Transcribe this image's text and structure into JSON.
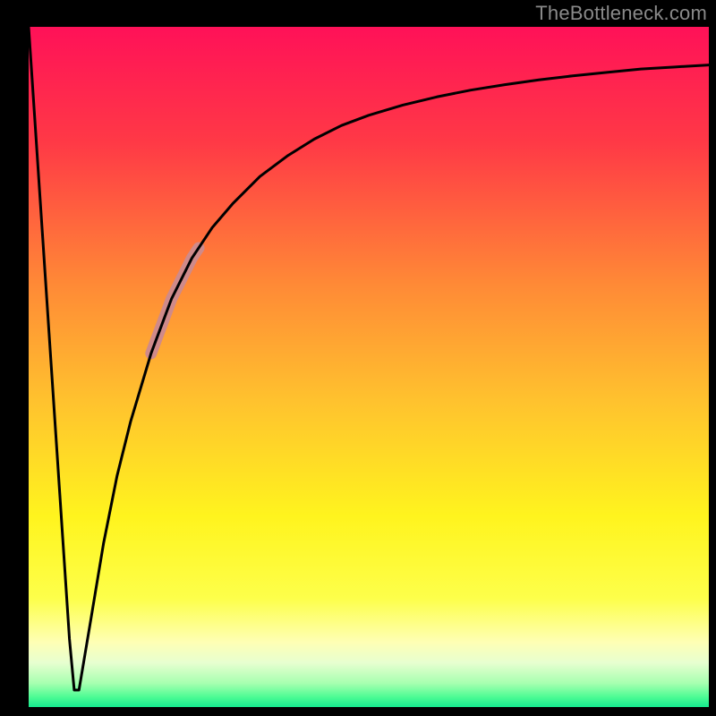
{
  "attribution": "TheBottleneck.com",
  "colors": {
    "frame": "#000000",
    "attribution_text": "#8a8a8a",
    "curve": "#000000",
    "marker": "#cf8a8a"
  },
  "chart_data": {
    "type": "line",
    "title": "",
    "xlabel": "",
    "ylabel": "",
    "xlim": [
      0,
      100
    ],
    "ylim": [
      0,
      100
    ],
    "grid": false,
    "legend": false,
    "background_gradient": {
      "stops": [
        {
          "offset": 0.0,
          "color": "#ff1158"
        },
        {
          "offset": 0.17,
          "color": "#ff3946"
        },
        {
          "offset": 0.38,
          "color": "#ff8a36"
        },
        {
          "offset": 0.55,
          "color": "#ffc22e"
        },
        {
          "offset": 0.72,
          "color": "#fff41e"
        },
        {
          "offset": 0.84,
          "color": "#fdff4a"
        },
        {
          "offset": 0.905,
          "color": "#feffb5"
        },
        {
          "offset": 0.935,
          "color": "#e7ffd0"
        },
        {
          "offset": 0.965,
          "color": "#a7ffb0"
        },
        {
          "offset": 0.985,
          "color": "#4efc94"
        },
        {
          "offset": 1.0,
          "color": "#15e98e"
        }
      ]
    },
    "series": [
      {
        "name": "bottleneck-curve",
        "comment": "x in 0..100, y is bottleneck% (0=green/good at bottom, 100=red/top). Values estimated from pixel positions.",
        "x": [
          0,
          1,
          2,
          3,
          4,
          5,
          6,
          6.7,
          7.4,
          9,
          11,
          13,
          15,
          18,
          21,
          24,
          27,
          30,
          34,
          38,
          42,
          46,
          50,
          55,
          60,
          65,
          70,
          75,
          80,
          85,
          90,
          95,
          100
        ],
        "y": [
          100,
          85,
          70,
          55,
          40,
          25,
          10,
          2.5,
          2.5,
          12,
          24,
          34,
          42,
          52,
          60,
          66,
          70.5,
          74,
          78,
          81,
          83.5,
          85.5,
          87,
          88.5,
          89.7,
          90.7,
          91.5,
          92.2,
          92.8,
          93.3,
          93.8,
          94.1,
          94.4
        ]
      }
    ],
    "marker": {
      "comment": "Thick pink stroke overlaid on the curve in this x-range.",
      "x_start": 18,
      "x_end": 25,
      "thickness_px": 13
    }
  }
}
